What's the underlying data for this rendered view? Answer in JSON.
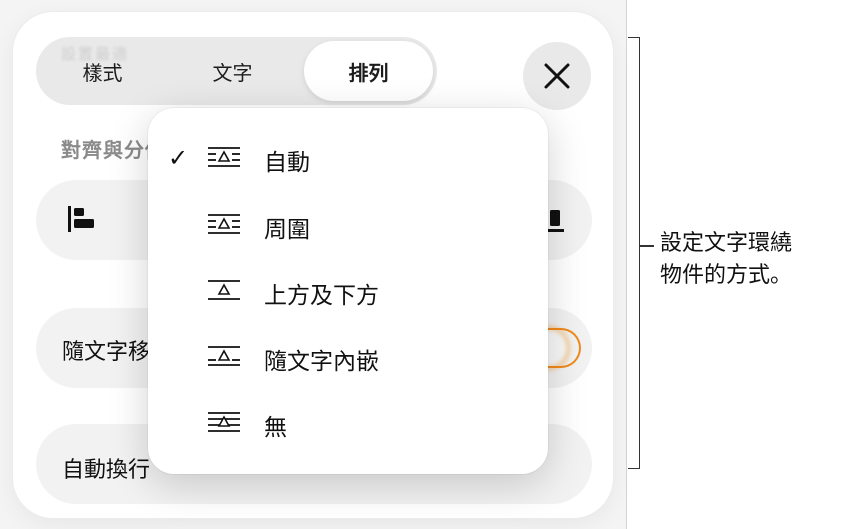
{
  "tabs": {
    "style": "樣式",
    "text": "文字",
    "arrange": "排列",
    "ghost": "設置最適"
  },
  "close_icon": "close-icon",
  "section": {
    "label": "對齊與分佈"
  },
  "move_with_text": {
    "label": "隨文字移動",
    "toggle_on": true,
    "toggle_color": "#f39a2a"
  },
  "text_wrap": {
    "label": "自動換行"
  },
  "wrap_menu": {
    "items": [
      {
        "label": "自動",
        "checked": true,
        "icon": "wrap-auto-icon"
      },
      {
        "label": "周圍",
        "checked": false,
        "icon": "wrap-around-icon"
      },
      {
        "label": "上方及下方",
        "checked": false,
        "icon": "wrap-above-below-icon"
      },
      {
        "label": "隨文字內嵌",
        "checked": false,
        "icon": "wrap-inline-icon"
      },
      {
        "label": "無",
        "checked": false,
        "icon": "wrap-none-icon"
      }
    ],
    "check_mark": "✓"
  },
  "callout": {
    "line1": "設定文字環繞",
    "line2": "物件的方式。"
  }
}
